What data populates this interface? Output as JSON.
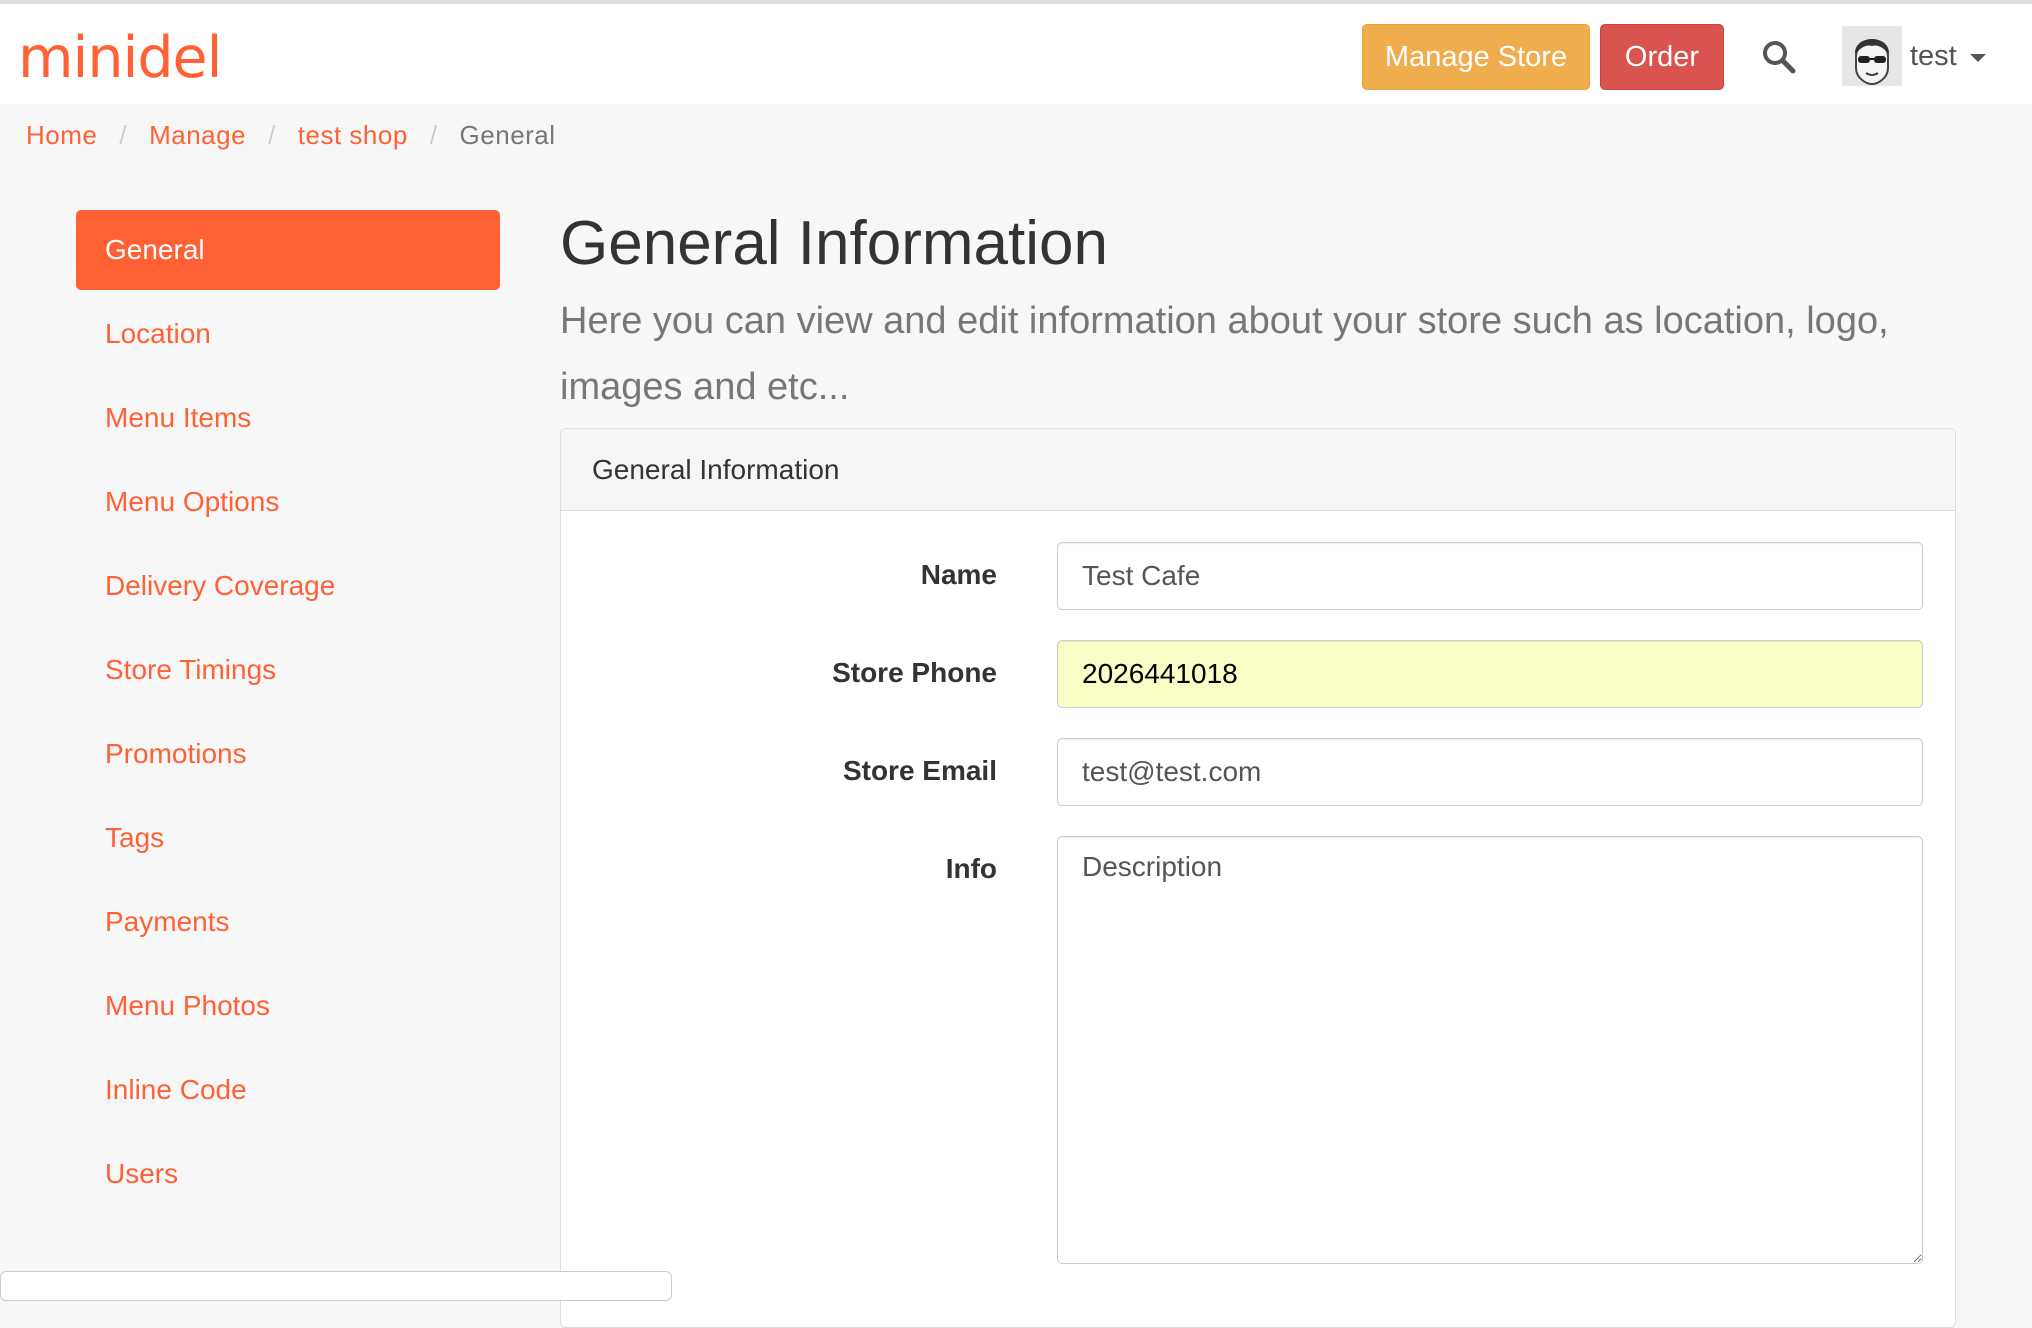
{
  "brand": {
    "logo_part1": "mini",
    "logo_part2": "del",
    "accent_color": "#ff6135"
  },
  "header": {
    "manage_store_label": "Manage Store",
    "order_label": "Order",
    "search_icon": "search-icon",
    "user_name": "test",
    "user_caret_icon": "caret-down-icon"
  },
  "breadcrumb": {
    "items": [
      "Home",
      "Manage",
      "test shop"
    ],
    "separator": "/",
    "active": "General"
  },
  "sidebar": {
    "items": [
      {
        "label": "General",
        "active": true
      },
      {
        "label": "Location"
      },
      {
        "label": "Menu Items"
      },
      {
        "label": "Menu Options"
      },
      {
        "label": "Delivery Coverage"
      },
      {
        "label": "Store Timings"
      },
      {
        "label": "Promotions"
      },
      {
        "label": "Tags"
      },
      {
        "label": "Payments"
      },
      {
        "label": "Menu Photos"
      },
      {
        "label": "Inline Code"
      },
      {
        "label": "Users"
      }
    ]
  },
  "main": {
    "title": "General Information",
    "lead": "Here you can view and edit information about your store such as location, logo, images and etc...",
    "panel": {
      "heading": "General Information",
      "fields": {
        "name": {
          "label": "Name",
          "value": "Test Cafe"
        },
        "phone": {
          "label": "Store Phone",
          "value": "2026441018"
        },
        "email": {
          "label": "Store Email",
          "value": "test@test.com"
        },
        "info": {
          "label": "Info",
          "placeholder": "Description"
        }
      }
    }
  }
}
